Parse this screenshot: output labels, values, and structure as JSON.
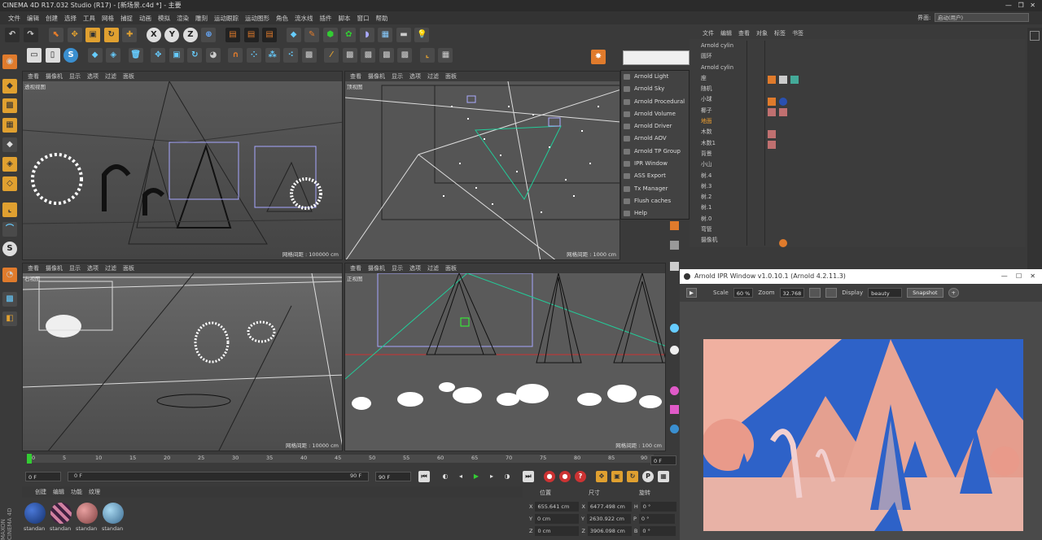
{
  "window": {
    "title": "CINEMA 4D R17.032 Studio (R17) - [新场景.c4d *] - 主要",
    "interface_label": "界面:",
    "interface_value": "启动(用户)"
  },
  "menubar": [
    "文件",
    "编辑",
    "创建",
    "选择",
    "工具",
    "网格",
    "捕捉",
    "动画",
    "模拟",
    "渲染",
    "雕刻",
    "运动跟踪",
    "运动图形",
    "角色",
    "流水线",
    "插件",
    "脚本",
    "窗口",
    "帮助"
  ],
  "viewport_menu": [
    "查看",
    "摄像机",
    "显示",
    "选项",
    "过滤",
    "面板"
  ],
  "viewports": [
    {
      "label": "透视视图",
      "grid": "网格间距 : 100000 cm"
    },
    {
      "label": "顶视图",
      "grid": "网格间距 : 1000 cm"
    },
    {
      "label": "右视图",
      "grid": "网格间距 : 10000 cm"
    },
    {
      "label": "正视图",
      "grid": "网格间距 : 100 cm"
    }
  ],
  "object_manager": {
    "menu": [
      "文件",
      "编辑",
      "查看",
      "对象",
      "标签",
      "书签"
    ],
    "objects": [
      "Arnold cylin",
      "圆环",
      "Arnold cylin",
      "座",
      "随机",
      "小球",
      "椰子",
      "地面",
      "木数",
      "木数1",
      "背景",
      "小山",
      "树.4",
      "树.3",
      "树.2",
      "树.1",
      "树.0",
      "弯管",
      "摄像机"
    ]
  },
  "arnold_menu": [
    "Arnold Light",
    "Arnold Sky",
    "Arnold Procedural",
    "Arnold Volume",
    "Arnold Driver",
    "Arnold AOV",
    "Arnold TP Group",
    "IPR Window",
    "ASS Export",
    "Tx Manager",
    "Flush caches",
    "Help"
  ],
  "ipr": {
    "title": "Arnold IPR Window v1.0.10.1 (Arnold 4.2.11.3)",
    "scale_label": "Scale",
    "scale": "60 %",
    "zoom_label": "Zoom",
    "zoom": "32.768",
    "display_label": "Display",
    "display": "beauty",
    "snapshot": "Snapshot"
  },
  "timeline": {
    "ticks": [
      "0",
      "5",
      "10",
      "15",
      "20",
      "25",
      "30",
      "35",
      "40",
      "45",
      "50",
      "55",
      "60",
      "65",
      "70",
      "75",
      "80",
      "85",
      "90"
    ],
    "current": "0 F",
    "start": "0 F",
    "field2": "0 F",
    "end_inner": "90 F",
    "end": "90 F",
    "right_field": "0 F"
  },
  "materials": {
    "menu": [
      "创建",
      "编辑",
      "功能",
      "纹理"
    ],
    "items": [
      "standan",
      "standan",
      "standan",
      "standan"
    ]
  },
  "coords": {
    "headers": [
      "位置",
      "尺寸",
      "旋转"
    ],
    "rows": [
      {
        "axis": "X",
        "pos": "655.641 cm",
        "saxis": "X",
        "size": "6477.498 cm",
        "raxis": "H",
        "rot": "0 °"
      },
      {
        "axis": "Y",
        "pos": "0 cm",
        "saxis": "Y",
        "size": "2630.922 cm",
        "raxis": "P",
        "rot": "0 °"
      },
      {
        "axis": "Z",
        "pos": "0 cm",
        "saxis": "Z",
        "size": "3906.098 cm",
        "raxis": "B",
        "rot": "0 °"
      }
    ]
  },
  "side_brand": "MAXON CINEMA 4D",
  "colors": {
    "accent": "#e07b2c",
    "background": "#3a3a3a",
    "render_pink": "#e9a08f",
    "render_blue": "#2e62c8"
  }
}
